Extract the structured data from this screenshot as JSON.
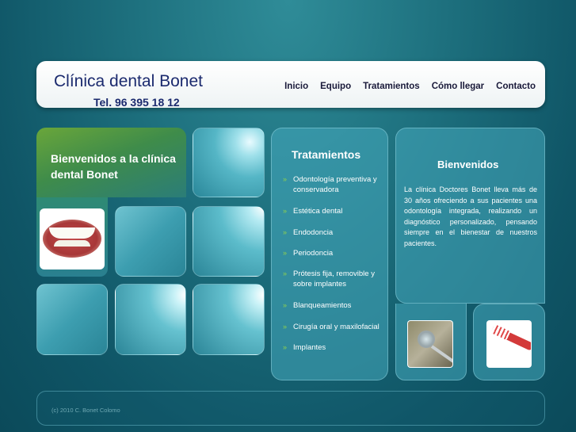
{
  "header": {
    "title": "Clínica dental Bonet",
    "phone": "Tel. 96 395 18 12",
    "nav": [
      "Inicio",
      "Equipo",
      "Tratamientos",
      "Cómo llegar",
      "Contacto"
    ]
  },
  "welcome_box": {
    "text": "Bienvenidos a la clínica dental Bonet"
  },
  "treatments": {
    "title": "Tratamientos",
    "items": [
      "Odontología preventiva y conservadora",
      "Estética dental",
      "Endodoncia",
      "Periodoncia",
      "Prótesis fija, removible y sobre implantes",
      "Blanqueamientos",
      "Cirugía oral y maxilofacial",
      "Implantes"
    ]
  },
  "welcome_panel": {
    "title": "Bienvenidos",
    "body": "La clínica Doctores Bonet lleva más de 30 años ofreciendo a sus pacientes una odontología integrada, realizando un diagnóstico personalizado, pensando siempre en el bienestar de nuestros pacientes."
  },
  "footer": {
    "text": "(c) 2010 C. Bonet Colomo"
  },
  "colors": {
    "title_blue": "#1b2a6e",
    "arrow_green": "#8fd14f",
    "background": "#1d6f7d"
  }
}
